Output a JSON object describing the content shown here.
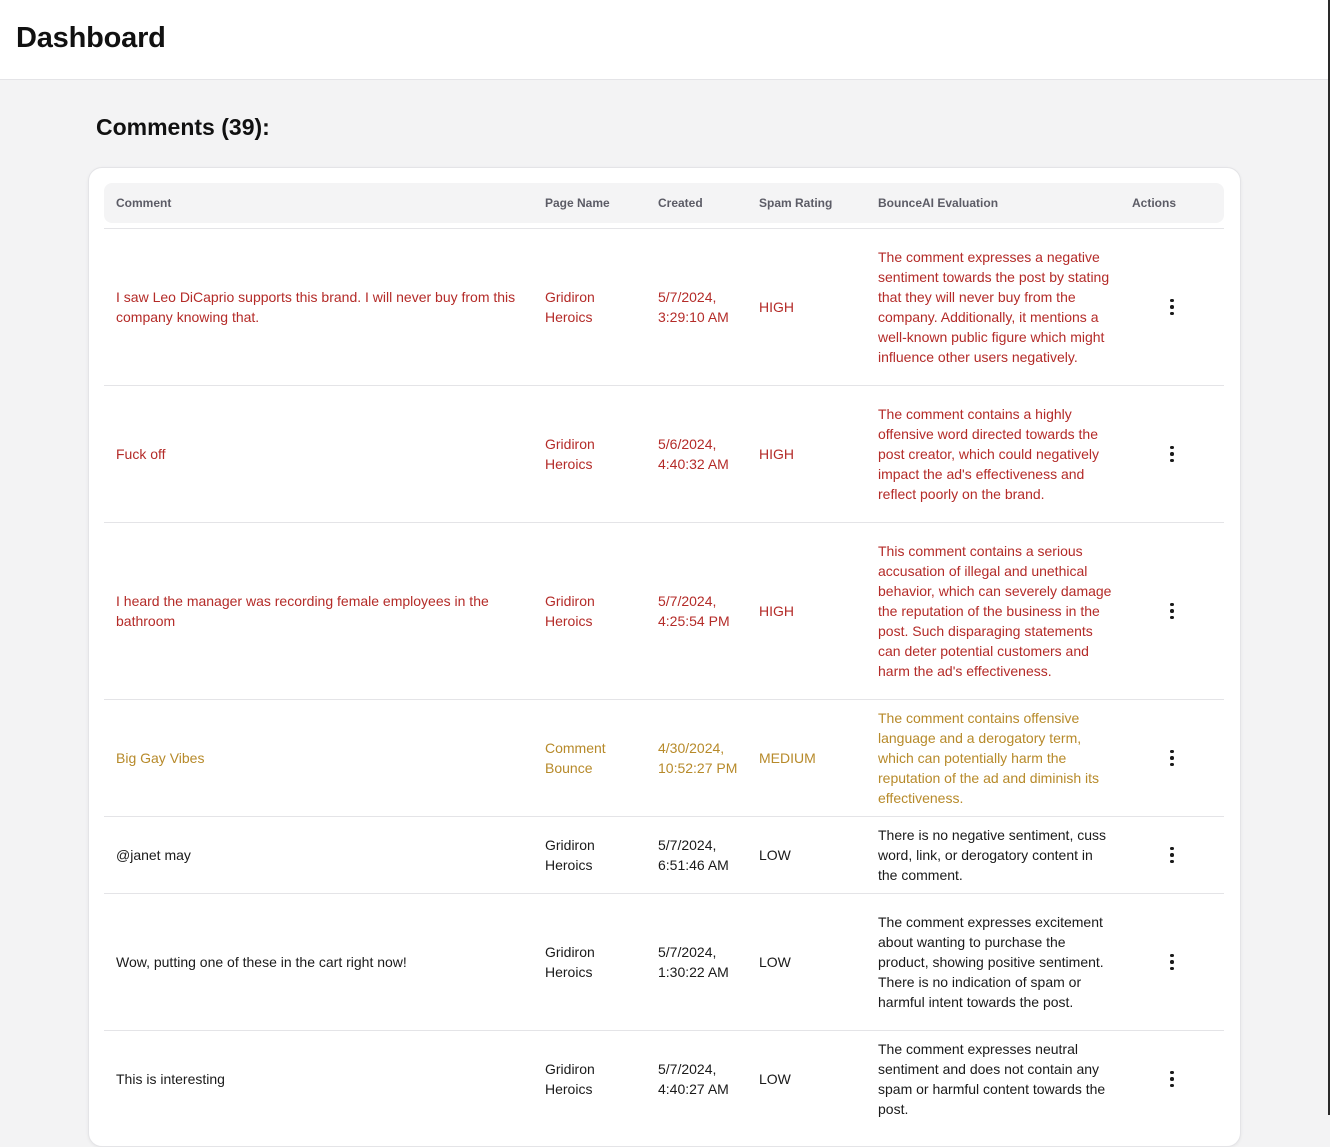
{
  "header": {
    "title": "Dashboard"
  },
  "section": {
    "title": "Comments (39):"
  },
  "table": {
    "columns": [
      "Comment",
      "Page Name",
      "Created",
      "Spam Rating",
      "BounceAI Evaluation",
      "Actions"
    ],
    "rows": [
      {
        "comment": "I saw Leo DiCaprio supports this brand. I will never buy from this company knowing that.",
        "page": "Gridiron Heroics",
        "created": "5/7/2024, 3:29:10 AM",
        "rating": "HIGH",
        "evaluation": "The comment expresses a negative sentiment towards the post by stating that they will never buy from the company. Additionally, it mentions a well-known public figure which might influence other users negatively."
      },
      {
        "comment": "Fuck off",
        "page": "Gridiron Heroics",
        "created": "5/6/2024, 4:40:32 AM",
        "rating": "HIGH",
        "evaluation": "The comment contains a highly offensive word directed towards the post creator, which could negatively impact the ad's effectiveness and reflect poorly on the brand."
      },
      {
        "comment": "I heard the manager was recording female employees in the bathroom",
        "page": "Gridiron Heroics",
        "created": "5/7/2024, 4:25:54 PM",
        "rating": "HIGH",
        "evaluation": "This comment contains a serious accusation of illegal and unethical behavior, which can severely damage the reputation of the business in the post. Such disparaging statements can deter potential customers and harm the ad's effectiveness."
      },
      {
        "comment": "Big Gay Vibes",
        "page": "Comment Bounce",
        "created": "4/30/2024, 10:52:27 PM",
        "rating": "MEDIUM",
        "evaluation": "The comment contains offensive language and a derogatory term, which can potentially harm the reputation of the ad and diminish its effectiveness."
      },
      {
        "comment": "@janet may",
        "page": "Gridiron Heroics",
        "created": "5/7/2024, 6:51:46 AM",
        "rating": "LOW",
        "evaluation": "There is no negative sentiment, cuss word, link, or derogatory content in the comment."
      },
      {
        "comment": "Wow, putting one of these in the cart right now!",
        "page": "Gridiron Heroics",
        "created": "5/7/2024, 1:30:22 AM",
        "rating": "LOW",
        "evaluation": "The comment expresses excitement about wanting to purchase the product, showing positive sentiment. There is no indication of spam or harmful intent towards the post."
      },
      {
        "comment": "This is interesting",
        "page": "Gridiron Heroics",
        "created": "5/7/2024, 4:40:27 AM",
        "rating": "LOW",
        "evaluation": "The comment expresses neutral sentiment and does not contain any spam or harmful content towards the post."
      }
    ]
  },
  "colors": {
    "high": "#b42b28",
    "medium": "#b78a2a",
    "low": "#1a1a1a"
  },
  "icons": {
    "actions": "kebab-menu-icon"
  }
}
